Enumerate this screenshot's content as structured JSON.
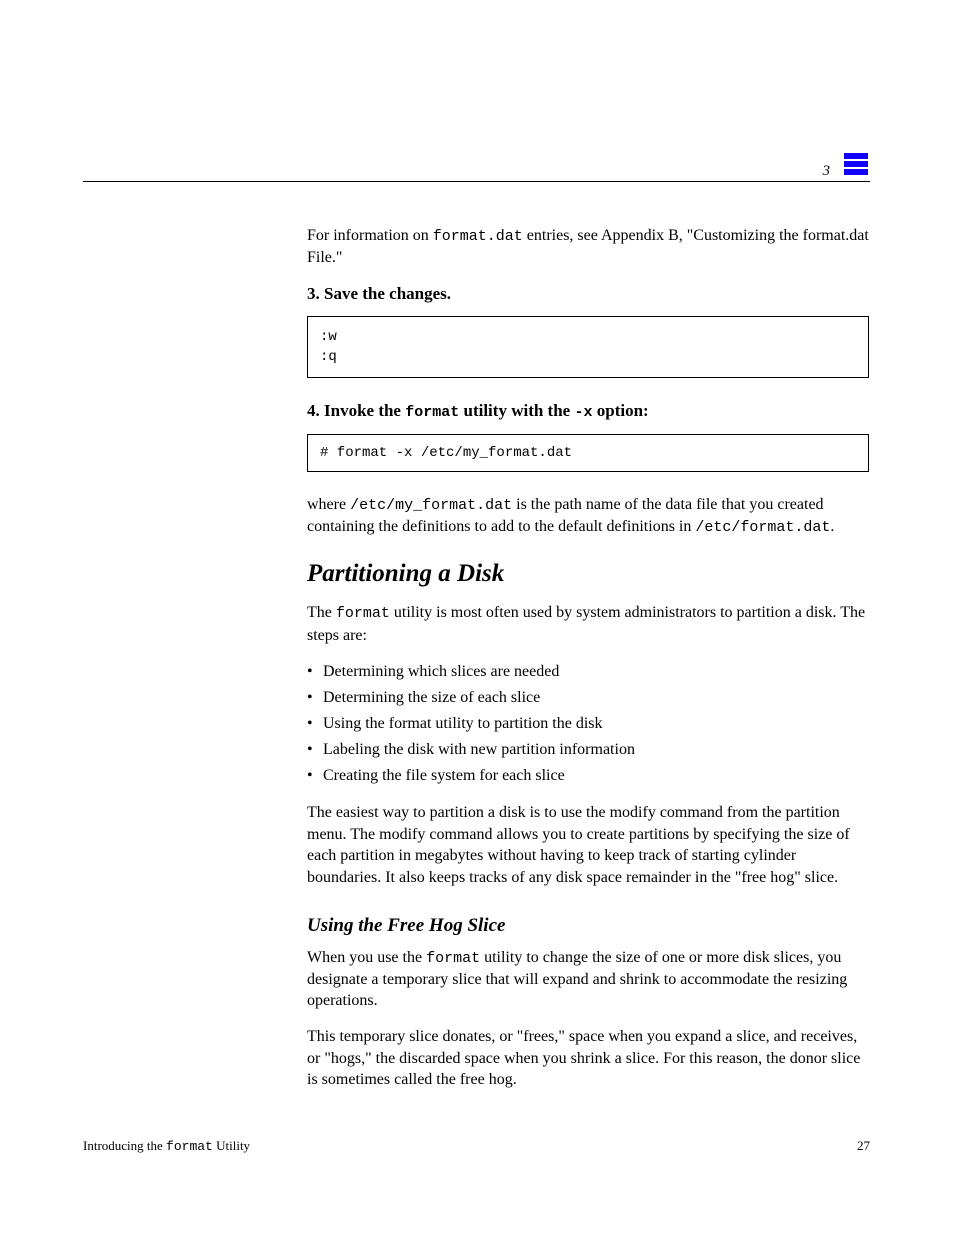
{
  "header": {
    "chapter_label": "3"
  },
  "body": {
    "intro_para_prefix": "For information on ",
    "intro_para_code": "format.dat",
    "intro_para_suffix": " entries, see Appendix B, \"Customizing the format.dat File.\"",
    "step3": {
      "num": "3. ",
      "label": "Save the changes."
    },
    "code1": ":w\n:q",
    "step4": {
      "num": "4. ",
      "label_prefix": "Invoke the ",
      "label_code": "format",
      "label_mid": " utility with the ",
      "label_flag": "-x",
      "label_suffix": " option:"
    },
    "code2": "# format -x /etc/my_format.dat",
    "step4_tail_prefix": "where ",
    "step4_tail_code": "/etc/my_format.dat",
    "step4_tail_mid": " is the path name of the data file that you created containing the definitions to add to the default definitions in ",
    "step4_tail_path": "/etc/format.dat",
    "step4_tail_end": ".",
    "h2": "Partitioning a Disk",
    "partition_para_prefix": "The ",
    "partition_para_code": "format",
    "partition_para_suffix": " utility is most often used by system administrators to partition a disk. The steps are:",
    "bullets": [
      "Determining which slices are needed",
      "Determining the size of each slice",
      "Using the format utility to partition the disk",
      "Labeling the disk with new partition information",
      "Creating the file system for each slice"
    ],
    "partition_closing": "The easiest way to partition a disk is to use the modify command from the partition menu. The modify command allows you to create partitions by specifying the size of each partition in megabytes without having to keep track of starting cylinder boundaries. It also keeps tracks of any disk space remainder in the \"free hog\" slice.",
    "h3": "Using the Free Hog Slice",
    "freehog_p1_prefix": "When you use the ",
    "freehog_p1_code": "format",
    "freehog_p1_suffix": " utility to change the size of one or more disk slices, you designate a temporary slice that will expand and shrink to accommodate the resizing operations.",
    "freehog_p2": "This temporary slice donates, or \"frees,\" space when you expand a slice, and receives, or \"hogs,\" the discarded space when you shrink a slice. For this reason, the donor slice is sometimes called the free hog."
  },
  "footer": {
    "title_prefix": "Introducing the ",
    "title_code": "format",
    "title_suffix": " Utility",
    "page": "27"
  }
}
